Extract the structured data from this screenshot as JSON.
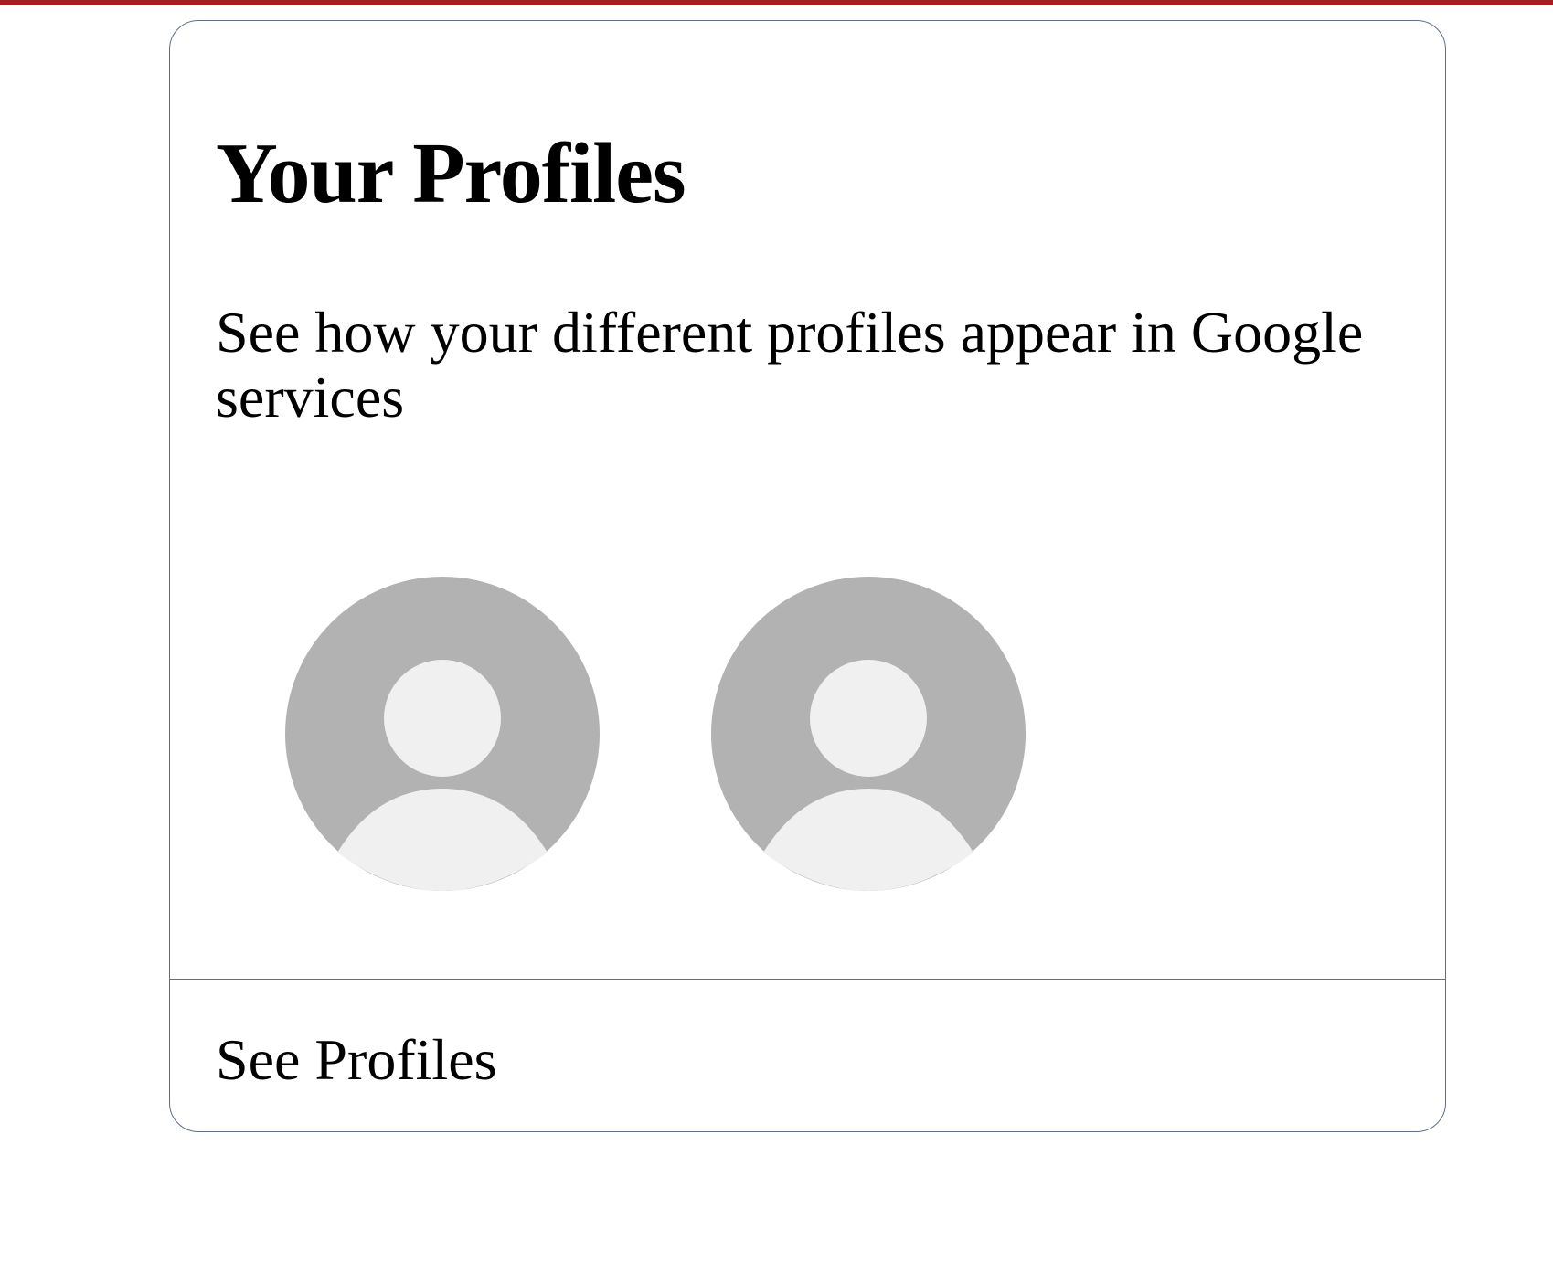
{
  "colors": {
    "top_bar": "#a51d22",
    "card_border": "#5f6f8a",
    "avatar_background": "#b2b2b2",
    "avatar_figure": "#f0f0f0"
  },
  "card": {
    "title": "Your Profiles",
    "description": "See how your different profiles appear in Google services",
    "avatars": [
      {
        "icon": "default-avatar-icon"
      },
      {
        "icon": "default-avatar-icon"
      }
    ],
    "link_label": "See Profiles"
  }
}
